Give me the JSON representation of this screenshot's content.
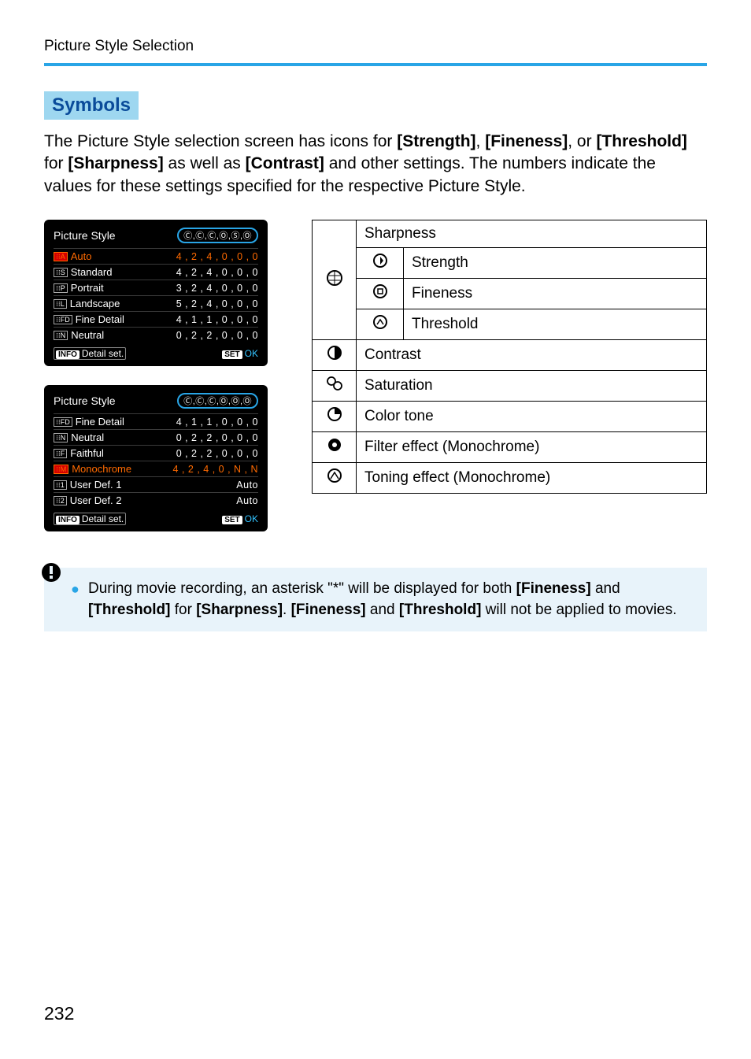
{
  "page": {
    "breadcrumb": "Picture Style Selection",
    "number": "232"
  },
  "section": {
    "heading": "Symbols",
    "intro_1": "The Picture Style selection screen has icons for ",
    "intro_b1": "[Strength]",
    "intro_2": ", ",
    "intro_b2": "[Fineness]",
    "intro_3": ", or ",
    "intro_b3": "[Threshold]",
    "intro_4": " for ",
    "intro_b4": "[Sharpness]",
    "intro_5": " as well as ",
    "intro_b5": "[Contrast]",
    "intro_6": " and other settings. The numbers indicate the values for these settings specified for the respective Picture Style."
  },
  "panel1": {
    "title": "Picture Style",
    "bubble": "Ⓒ,Ⓒ,Ⓒ,Ⓞ,Ⓢ,Ⓞ",
    "rows": [
      {
        "chip": "A",
        "chipClass": "style-chip-red",
        "name": "Auto",
        "vals": "4 , 2 , 4 , 0 , 0 , 0",
        "hl": true
      },
      {
        "chip": "S",
        "chipClass": "",
        "name": "Standard",
        "vals": "4 , 2 , 4 , 0 , 0 , 0",
        "hl": false
      },
      {
        "chip": "P",
        "chipClass": "",
        "name": "Portrait",
        "vals": "3 , 2 , 4 , 0 , 0 , 0",
        "hl": false
      },
      {
        "chip": "L",
        "chipClass": "",
        "name": "Landscape",
        "vals": "5 , 2 , 4 , 0 , 0 , 0",
        "hl": false
      },
      {
        "chip": "FD",
        "chipClass": "",
        "name": "Fine Detail",
        "vals": "4 , 1 , 1 , 0 , 0 , 0",
        "hl": false
      },
      {
        "chip": "N",
        "chipClass": "",
        "name": "Neutral",
        "vals": "0 , 2 , 2 , 0 , 0 , 0",
        "hl": false
      }
    ],
    "foot_info": "INFO",
    "foot_detail": "Detail set.",
    "foot_set": "SET",
    "foot_ok": "OK"
  },
  "panel2": {
    "title": "Picture Style",
    "bubble": "Ⓒ,Ⓒ,Ⓒ,Ⓞ,Ⓞ,Ⓞ",
    "rows": [
      {
        "chip": "FD",
        "chipClass": "",
        "name": "Fine Detail",
        "vals": "4 , 1 , 1 , 0 , 0 , 0",
        "hl": false
      },
      {
        "chip": "N",
        "chipClass": "",
        "name": "Neutral",
        "vals": "0 , 2 , 2 , 0 , 0 , 0",
        "hl": false
      },
      {
        "chip": "F",
        "chipClass": "",
        "name": "Faithful",
        "vals": "0 , 2 , 2 , 0 , 0 , 0",
        "hl": false
      },
      {
        "chip": "M",
        "chipClass": "style-chip-red",
        "name": "Monochrome",
        "vals": "4 , 2 , 4 , 0 , N , N",
        "hl": true
      },
      {
        "chip": "1",
        "chipClass": "",
        "name": "User Def. 1",
        "vals": "Auto",
        "hl": false
      },
      {
        "chip": "2",
        "chipClass": "",
        "name": "User Def. 2",
        "vals": "Auto",
        "hl": false
      }
    ],
    "foot_info": "INFO",
    "foot_detail": "Detail set.",
    "foot_set": "SET",
    "foot_ok": "OK"
  },
  "symbols": {
    "sharpness": "Sharpness",
    "strength": "Strength",
    "fineness": "Fineness",
    "threshold": "Threshold",
    "contrast": "Contrast",
    "saturation": "Saturation",
    "color_tone": "Color tone",
    "filter": "Filter effect (Monochrome)",
    "toning": "Toning effect (Monochrome)"
  },
  "note": {
    "t1": "During movie recording, an asterisk \"*\" will be displayed for both ",
    "b1": "[Fineness]",
    "t2": " and ",
    "b2": "[Threshold]",
    "t3": " for ",
    "b3": "[Sharpness]",
    "t4": ". ",
    "b4": "[Fineness]",
    "t5": " and ",
    "b5": "[Threshold]",
    "t6": " will not be applied to movies."
  }
}
